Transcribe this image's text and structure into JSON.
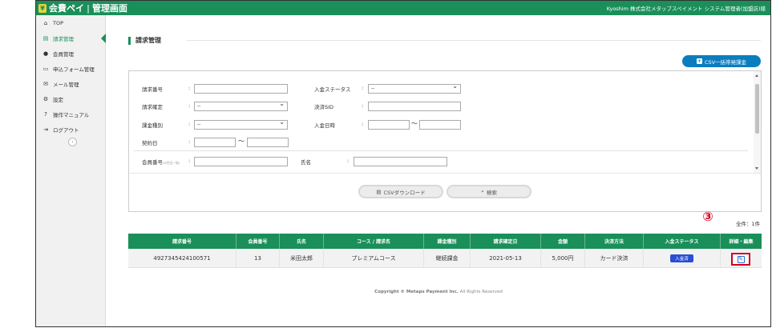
{
  "header": {
    "logo_name": "会費ペイ",
    "logo_sep": "|",
    "logo_admin": "管理画面",
    "user": "Kyoshim 株式会社メタップスペイメント システム管理者(加盟店)様"
  },
  "sidebar": {
    "items": [
      {
        "icon": "⌂",
        "label": "TOP"
      },
      {
        "icon": "▤",
        "label": "請求管理"
      },
      {
        "icon": "●",
        "label": "会員管理"
      },
      {
        "icon": "▭",
        "label": "申込フォーム管理"
      },
      {
        "icon": "✉",
        "label": "メール管理"
      },
      {
        "icon": "⚙",
        "label": "設定"
      },
      {
        "icon": "?",
        "label": "操作マニュアル"
      },
      {
        "icon": "⇥",
        "label": "ログアウト"
      }
    ],
    "collapse_icon": "‹"
  },
  "page": {
    "title": "請求管理",
    "csv_bulk_label": "CSV一括帯発課金"
  },
  "search": {
    "invoice_no_label": "請求番号",
    "payment_status_label": "入金ステータス",
    "payment_status_value": "--",
    "invoice_confirm_label": "請求確定",
    "invoice_confirm_value": "--",
    "payment_sid_label": "決済SID",
    "billing_type_label": "課金種別",
    "billing_type_value": "--",
    "payment_date_label": "入金日時",
    "contract_date_label": "契約日",
    "member_no_label": "会員番号",
    "member_no_note": "(※完全一致)",
    "name_label": "氏名",
    "colon": ":",
    "tilde": "〜",
    "csv_download_label": "CSVダウンロード",
    "search_label": "検索"
  },
  "results": {
    "count": "全件：1件",
    "annotation": "③",
    "columns": [
      "請求番号",
      "会員番号",
      "氏名",
      "コース / 請求名",
      "課金種別",
      "請求確定日",
      "金額",
      "決済方法",
      "入金ステータス",
      "詳細・編集"
    ],
    "rows": [
      {
        "invoice_no": "4927345424100571",
        "member_no": "13",
        "name": "米田太郎",
        "course": "プレミアムコース",
        "billing_type": "継続課金",
        "confirm_date": "2021-05-13",
        "amount": "5,000円",
        "payment_method": "カード決済",
        "status": "入金済"
      }
    ]
  },
  "footer": {
    "copyright": "Copyright © Metaps Payment Inc.",
    "rights": "All Rights Reserved"
  },
  "colors": {
    "brand_green": "#1a8f5a",
    "button_blue": "#0b7dbf",
    "badge_blue": "#2a4fd4",
    "annotation_red": "#d0021b"
  }
}
